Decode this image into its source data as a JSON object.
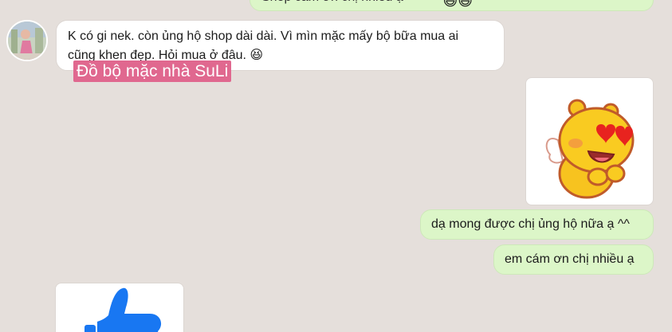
{
  "messages": {
    "top_outgoing": {
      "text": "Shop cảm ơn chị nhiều ạ"
    },
    "incoming": {
      "line1": "K có gi nek. còn ủng hộ shop dài dài. Vì mìn mặc mấy bộ bữa mua ai",
      "line2": "cũng khen đẹp. Hỏi mua ở đâu.",
      "emoji": "😆"
    },
    "outgoing_1": {
      "text": "dạ mong được chị ủng hộ nữa ạ ^^"
    },
    "outgoing_2": {
      "text": "em cám ơn chị nhiều ạ"
    }
  },
  "watermark": {
    "text": "Đồ bộ mặc nhà SuLi"
  },
  "colors": {
    "background": "#e5dfdb",
    "outgoing_bubble": "#dcf6c8",
    "incoming_bubble": "#ffffff",
    "watermark": "#e0688f",
    "like_blue": "#1877f2"
  }
}
